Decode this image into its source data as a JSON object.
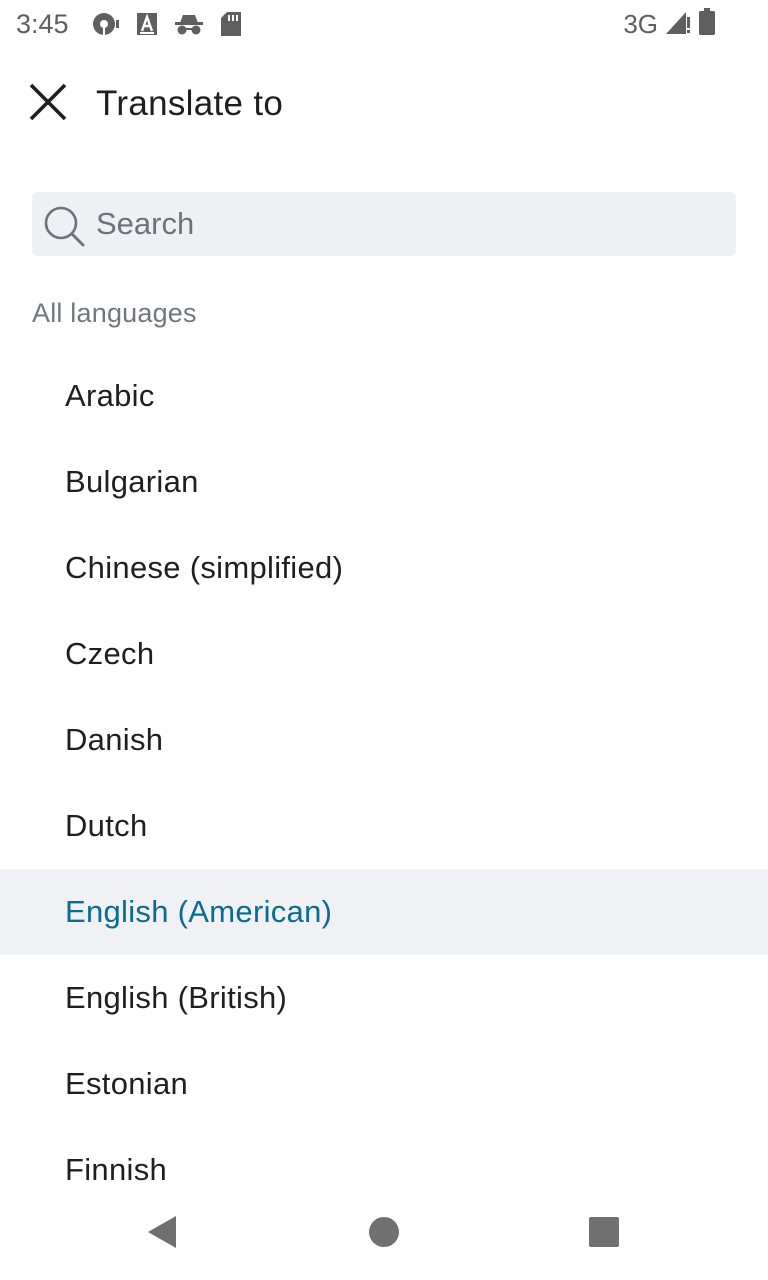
{
  "status_bar": {
    "time": "3:45",
    "network_type": "3G",
    "left_icons": [
      "podcast-icon",
      "text-a-icon",
      "incognito-icon",
      "sd-card-icon"
    ],
    "right_icons": [
      "signal-icon",
      "battery-icon"
    ]
  },
  "app_bar": {
    "title": "Translate to",
    "close_icon": "close-icon"
  },
  "search": {
    "placeholder": "Search",
    "value": "",
    "icon": "search-icon"
  },
  "section": {
    "header": "All languages"
  },
  "languages": [
    {
      "label": "Arabic",
      "selected": false
    },
    {
      "label": "Bulgarian",
      "selected": false
    },
    {
      "label": "Chinese (simplified)",
      "selected": false
    },
    {
      "label": "Czech",
      "selected": false
    },
    {
      "label": "Danish",
      "selected": false
    },
    {
      "label": "Dutch",
      "selected": false
    },
    {
      "label": "English (American)",
      "selected": true
    },
    {
      "label": "English (British)",
      "selected": false
    },
    {
      "label": "Estonian",
      "selected": false
    },
    {
      "label": "Finnish",
      "selected": false
    }
  ],
  "colors": {
    "selected_text": "#0b6b93",
    "selected_background": "#f0f1f5",
    "search_background": "#eff0f4",
    "section_header": "#6f7880"
  },
  "nav_bar": {
    "icons": [
      "back-icon",
      "home-icon",
      "recents-icon"
    ]
  }
}
